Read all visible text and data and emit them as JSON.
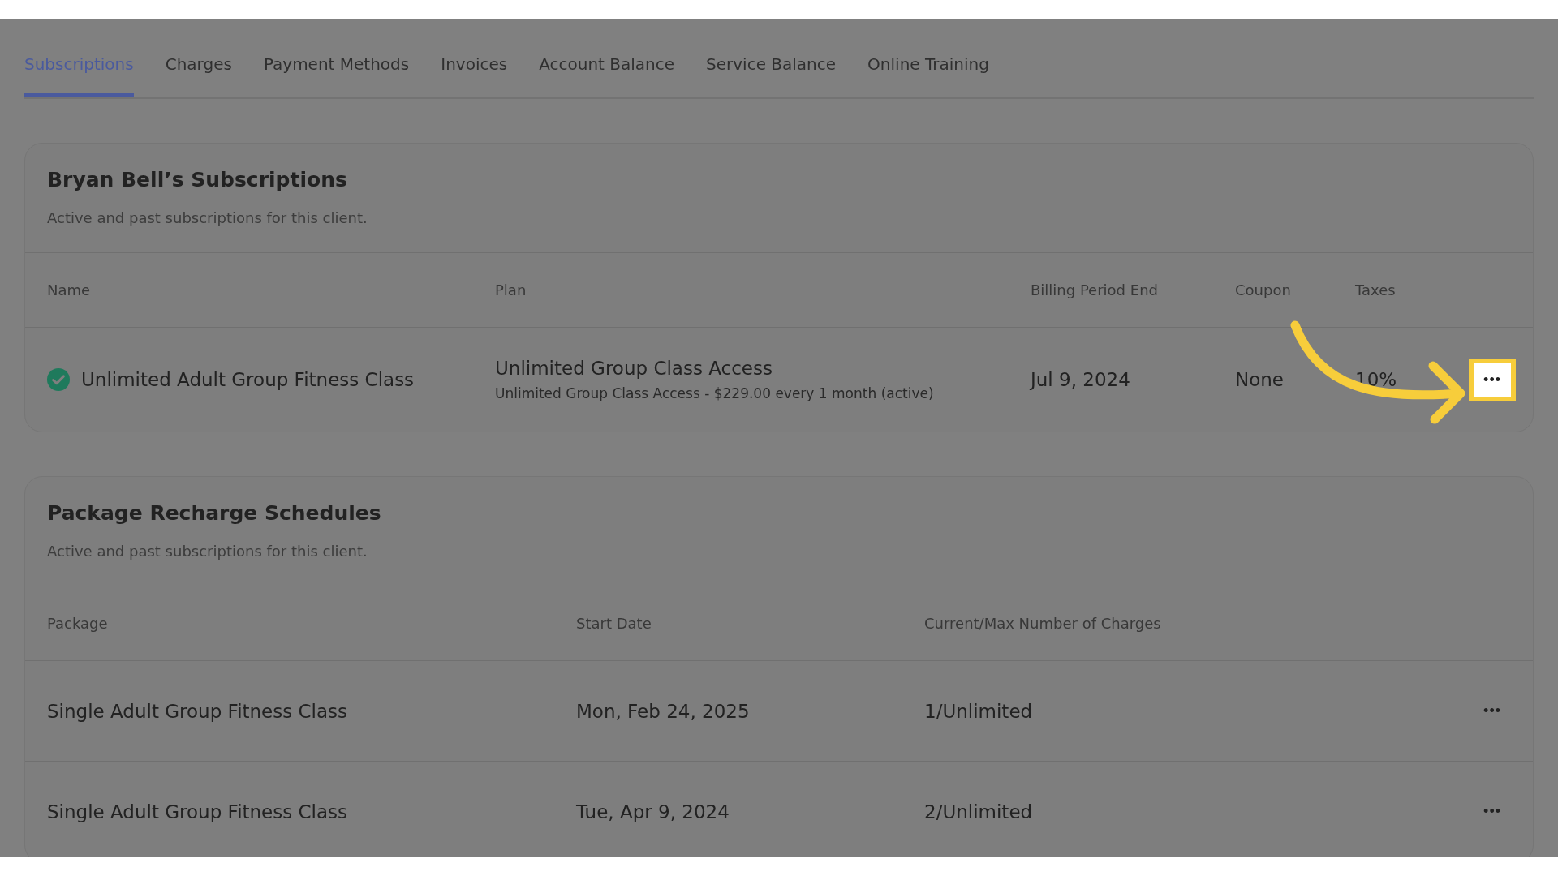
{
  "tabs": [
    {
      "label": "Subscriptions",
      "selected": true
    },
    {
      "label": "Charges",
      "selected": false
    },
    {
      "label": "Payment Methods",
      "selected": false
    },
    {
      "label": "Invoices",
      "selected": false
    },
    {
      "label": "Account Balance",
      "selected": false
    },
    {
      "label": "Service Balance",
      "selected": false
    },
    {
      "label": "Online Training",
      "selected": false
    }
  ],
  "subscriptions": {
    "title": "Bryan Bell’s Subscriptions",
    "subtitle": "Active and past subscriptions for this client.",
    "columns": [
      "Name",
      "Plan",
      "Billing Period End",
      "Coupon",
      "Taxes"
    ],
    "rows": [
      {
        "active": true,
        "name": "Unlimited Adult Group Fitness Class",
        "plan": "Unlimited Group Class Access",
        "plan_detail": "Unlimited Group Class Access - $229.00 every 1 month (active)",
        "billing_period_end": "Jul 9, 2024",
        "coupon": "None",
        "taxes": "10%",
        "menu": "•••",
        "highlighted": true
      }
    ]
  },
  "package_recharge_schedules": {
    "title": "Package Recharge Schedules",
    "subtitle": "Active and past subscriptions for this client.",
    "columns": [
      "Package",
      "Start Date",
      "Current/Max Number of Charges"
    ],
    "rows": [
      {
        "package": "Single Adult Group Fitness Class",
        "start_date": "Mon, Feb 24, 2025",
        "charges": "1/Unlimited",
        "menu": "•••",
        "highlighted": false
      },
      {
        "package": "Single Adult Group Fitness Class",
        "start_date": "Tue, Apr 9, 2024",
        "charges": "2/Unlimited",
        "menu": "•••",
        "highlighted": false
      }
    ]
  }
}
